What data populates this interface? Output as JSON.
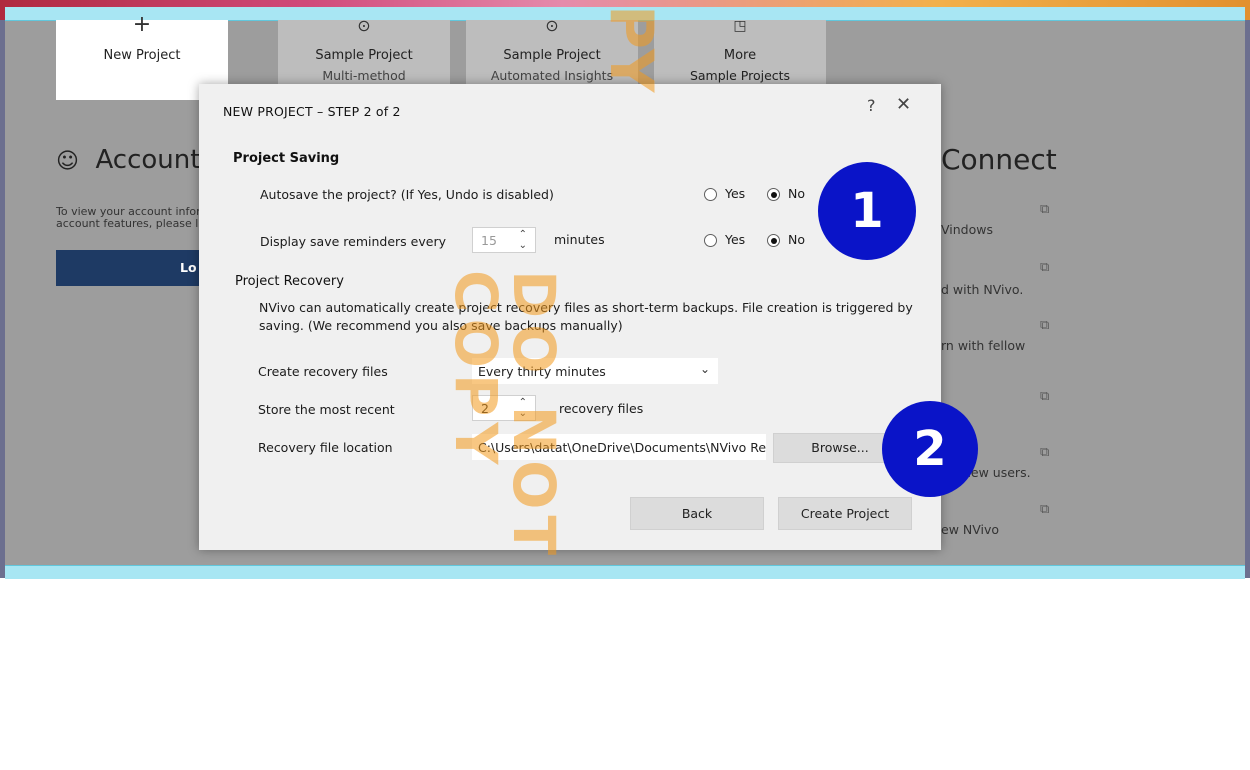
{
  "background": {
    "tiles": [
      {
        "title": "New Project",
        "sub": "",
        "icon": "plus-icon"
      },
      {
        "title": "Sample Project",
        "sub": "Multi-method",
        "icon": "download-icon"
      },
      {
        "title": "Sample Project",
        "sub": "Automated Insights",
        "icon": "download-icon"
      },
      {
        "title": "More",
        "sub": "Sample Projects",
        "icon": "external-link-icon"
      }
    ],
    "account_heading": "Account",
    "account_text_line1": "To view your account infor",
    "account_text_line2": "account features, please lo",
    "login_label": "Lo",
    "connect_heading": "Connect",
    "connect_items": [
      "Vindows",
      "d with NVivo.",
      "rn with fellow",
      "",
      "new users.",
      "ew NVivo"
    ]
  },
  "dialog": {
    "title": "NEW PROJECT – STEP 2 of 2",
    "help": "?",
    "close": "✕",
    "saving_heading": "Project Saving",
    "autosave_label": "Autosave the project?  (If Yes, Undo is disabled)",
    "autosave_yes": "Yes",
    "autosave_no": "No",
    "reminder_label": "Display save reminders every",
    "reminder_value": "15",
    "reminder_unit": "minutes",
    "reminder_yes": "Yes",
    "reminder_no": "No",
    "recovery_heading": "Project Recovery",
    "recovery_desc1": "NVivo can automatically create project recovery files as short-term backups. File creation is triggered by",
    "recovery_desc2": "saving. (We recommend you also save backups manually)",
    "create_label": "Create recovery files",
    "create_value": "Every thirty minutes",
    "store_label": "Store the most recent",
    "store_value": "2",
    "store_unit": "recovery files",
    "location_label": "Recovery file location",
    "location_value": "C:\\Users\\datat\\OneDrive\\Documents\\NVivo Re",
    "browse": "Browse...",
    "back": "Back",
    "create_project": "Create Project"
  },
  "badges": [
    "1",
    "2"
  ],
  "watermark": "DO NOT COPY"
}
